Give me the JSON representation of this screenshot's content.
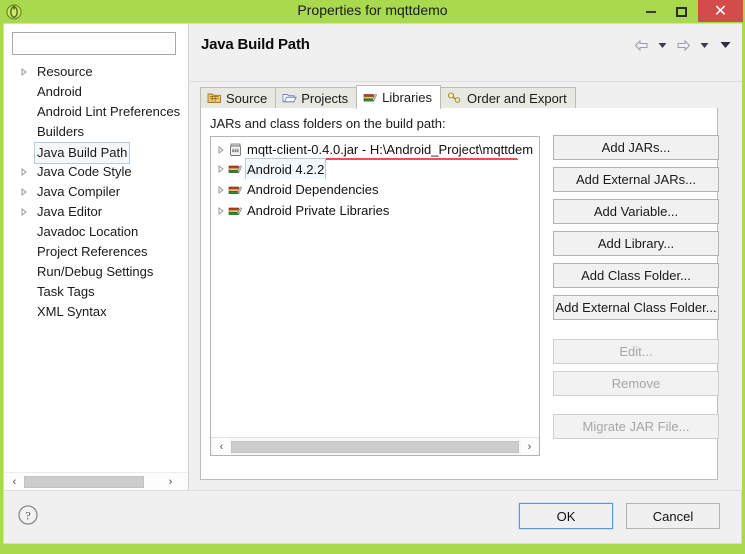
{
  "window": {
    "title": "Properties for mqttdemo",
    "app_icon": "eclipse-icon",
    "minimize_label": "",
    "maximize_label": "",
    "close_label": "✕",
    "titlebar_color": "#a9d94c",
    "close_button_color": "#d44b4b"
  },
  "sidebar": {
    "filter": {
      "value": "",
      "placeholder": ""
    },
    "items": [
      {
        "label": "Resource",
        "expandable": true,
        "selected": false
      },
      {
        "label": "Android",
        "expandable": false,
        "selected": false
      },
      {
        "label": "Android Lint Preferences",
        "expandable": false,
        "selected": false
      },
      {
        "label": "Builders",
        "expandable": false,
        "selected": false
      },
      {
        "label": "Java Build Path",
        "expandable": false,
        "selected": true
      },
      {
        "label": "Java Code Style",
        "expandable": true,
        "selected": false
      },
      {
        "label": "Java Compiler",
        "expandable": true,
        "selected": false
      },
      {
        "label": "Java Editor",
        "expandable": true,
        "selected": false
      },
      {
        "label": "Javadoc Location",
        "expandable": false,
        "selected": false
      },
      {
        "label": "Project References",
        "expandable": false,
        "selected": false
      },
      {
        "label": "Run/Debug Settings",
        "expandable": false,
        "selected": false
      },
      {
        "label": "Task Tags",
        "expandable": false,
        "selected": false
      },
      {
        "label": "XML Syntax",
        "expandable": false,
        "selected": false
      }
    ],
    "scroll_left_arrow": "‹",
    "scroll_right_arrow": "›"
  },
  "main": {
    "page_title": "Java Build Path",
    "nav": {
      "back_icon": "back-arrow-icon",
      "back_menu_icon": "chevron-down-icon",
      "forward_icon": "forward-arrow-icon",
      "forward_menu_icon": "chevron-down-icon",
      "view_menu_icon": "chevron-down-icon"
    },
    "tabs": [
      {
        "label": "Source",
        "icon": "source-folder-icon",
        "active": false
      },
      {
        "label": "Projects",
        "icon": "projects-folder-icon",
        "active": false
      },
      {
        "label": "Libraries",
        "icon": "libraries-books-icon",
        "active": true
      },
      {
        "label": "Order and Export",
        "icon": "order-export-icon",
        "active": false
      }
    ],
    "list_label": "JARs and class folders on the build path:",
    "libraries": [
      {
        "label": "mqtt-client-0.4.0.jar - H:\\Android_Project\\mqttdem",
        "icon": "jar-icon",
        "expandable": true,
        "selected": false,
        "annotated": true
      },
      {
        "label": "Android 4.2.2",
        "icon": "library-icon",
        "expandable": true,
        "selected": true,
        "annotated": false
      },
      {
        "label": "Android Dependencies",
        "icon": "library-icon",
        "expandable": true,
        "selected": false,
        "annotated": false
      },
      {
        "label": "Android Private Libraries",
        "icon": "library-icon",
        "expandable": true,
        "selected": false,
        "annotated": false
      }
    ],
    "list_scroll_left_arrow": "‹",
    "list_scroll_right_arrow": "›",
    "buttons": [
      {
        "label": "Add JARs...",
        "enabled": true,
        "group": 1
      },
      {
        "label": "Add External JARs...",
        "enabled": true,
        "group": 1
      },
      {
        "label": "Add Variable...",
        "enabled": true,
        "group": 1
      },
      {
        "label": "Add Library...",
        "enabled": true,
        "group": 1
      },
      {
        "label": "Add Class Folder...",
        "enabled": true,
        "group": 1
      },
      {
        "label": "Add External Class Folder...",
        "enabled": true,
        "group": 1
      },
      {
        "label": "Edit...",
        "enabled": false,
        "group": 2
      },
      {
        "label": "Remove",
        "enabled": false,
        "group": 2
      },
      {
        "label": "Migrate JAR File...",
        "enabled": false,
        "group": 3
      }
    ],
    "annotation_color": "#f0403a"
  },
  "footer": {
    "help_icon": "help-question-icon",
    "ok_label": "OK",
    "cancel_label": "Cancel",
    "ok_focus_color": "#5a96d2"
  }
}
